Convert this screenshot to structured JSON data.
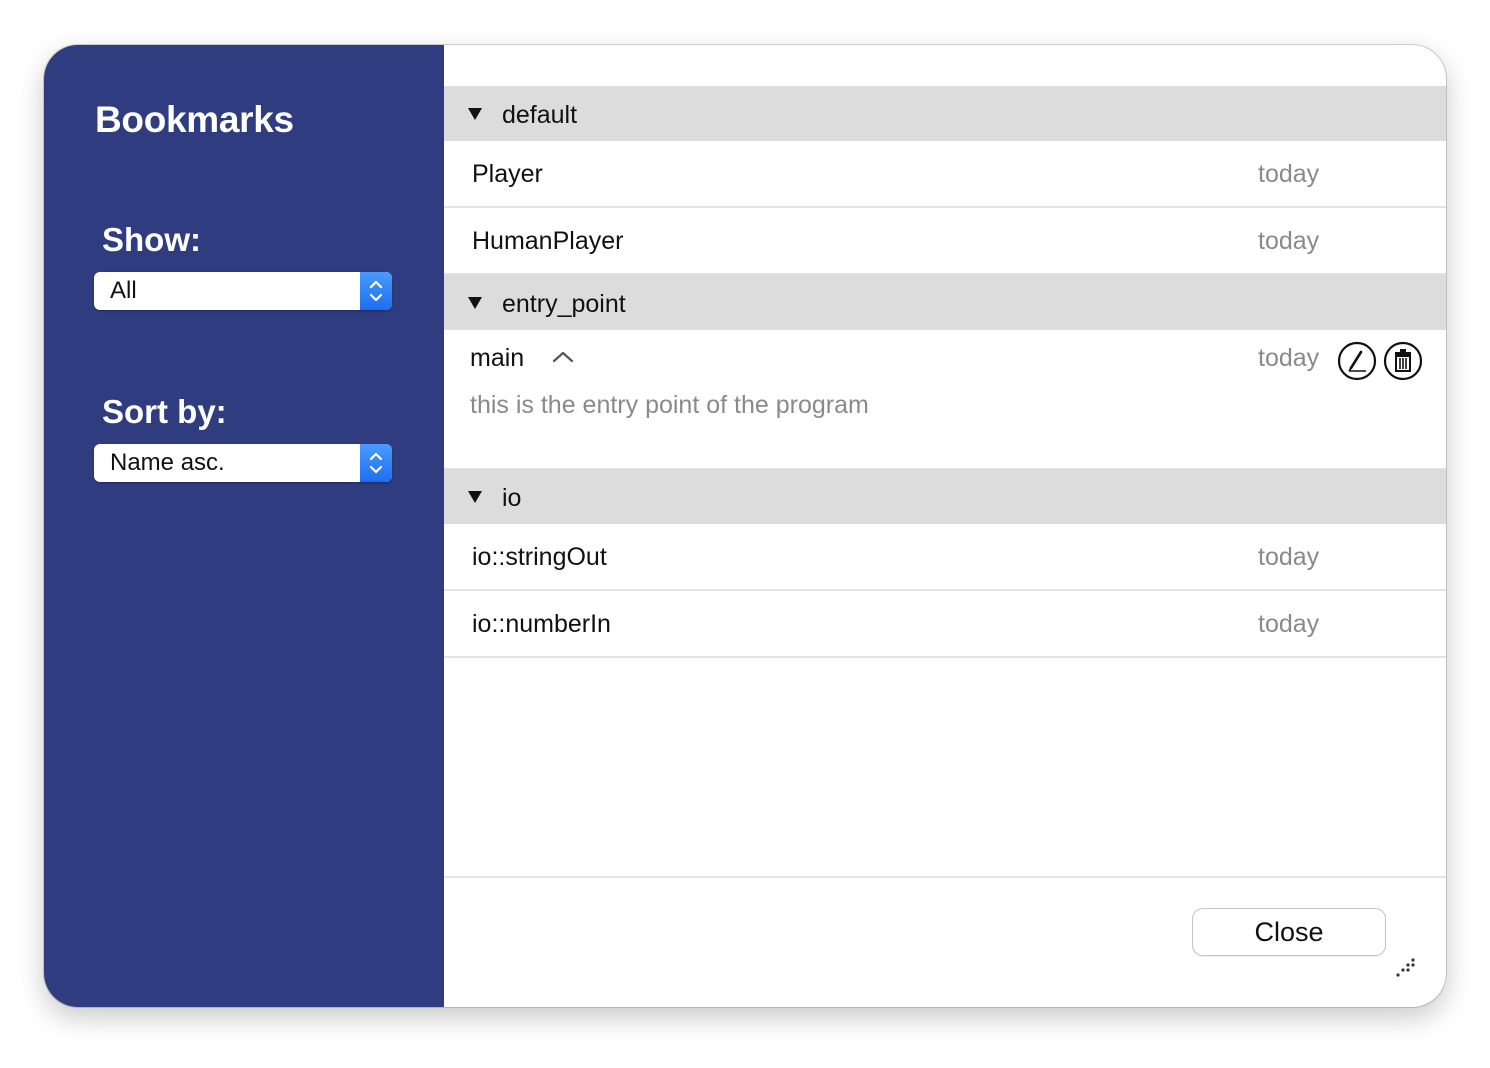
{
  "sidebar": {
    "title": "Bookmarks",
    "show": {
      "label": "Show:",
      "value": "All"
    },
    "sort": {
      "label": "Sort by:",
      "value": "Name asc."
    }
  },
  "groups": [
    {
      "name": "default",
      "items": [
        {
          "name": "Player",
          "date": "today"
        },
        {
          "name": "HumanPlayer",
          "date": "today"
        }
      ]
    },
    {
      "name": "entry_point",
      "items": [
        {
          "name": "main",
          "date": "today",
          "description": "this is the entry point of the program"
        }
      ]
    },
    {
      "name": "io",
      "items": [
        {
          "name": "io::stringOut",
          "date": "today"
        },
        {
          "name": "io::numberIn",
          "date": "today"
        }
      ]
    }
  ],
  "footer": {
    "close_label": "Close"
  },
  "icons": {
    "expand": "disclosure-triangle-icon",
    "collapse": "chevron-up-icon",
    "edit": "pencil-icon",
    "delete": "trash-icon",
    "resize": "resize-grip-icon",
    "stepper": "stepper-arrows-icon"
  },
  "colors": {
    "sidebar_bg": "#2f3d80",
    "group_header_bg": "#dcdcdc",
    "stepper_blue": "#2b7ff6"
  }
}
